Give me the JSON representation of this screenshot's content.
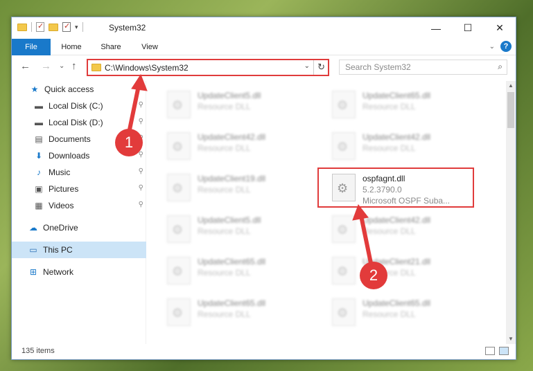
{
  "window": {
    "title": "System32",
    "minimize": "—",
    "maximize": "☐",
    "close": "✕"
  },
  "ribbon": {
    "tabs": [
      "File",
      "Home",
      "Share",
      "View"
    ],
    "help": "?",
    "expand": "⌄"
  },
  "nav": {
    "back": "←",
    "forward": "→",
    "recent": "⌄",
    "up": "↑",
    "address": "C:\\Windows\\System32",
    "address_dropdown": "⌄",
    "refresh": "↻",
    "search_placeholder": "Search System32",
    "search_icon": "⌕"
  },
  "sidebar": {
    "items": [
      {
        "label": "Quick access",
        "icon": "star-icon",
        "glyph": "★",
        "pinned": false
      },
      {
        "label": "Local Disk (C:)",
        "icon": "drive-icon",
        "glyph": "▬",
        "pinned": true
      },
      {
        "label": "Local Disk (D:)",
        "icon": "drive-icon",
        "glyph": "▬",
        "pinned": true
      },
      {
        "label": "Documents",
        "icon": "documents-icon",
        "glyph": "▤",
        "pinned": true
      },
      {
        "label": "Downloads",
        "icon": "download-icon",
        "glyph": "⬇",
        "pinned": true
      },
      {
        "label": "Music",
        "icon": "music-icon",
        "glyph": "♪",
        "pinned": true
      },
      {
        "label": "Pictures",
        "icon": "pictures-icon",
        "glyph": "▣",
        "pinned": true
      },
      {
        "label": "Videos",
        "icon": "videos-icon",
        "glyph": "▦",
        "pinned": true
      },
      {
        "label": "OneDrive",
        "icon": "cloud-icon",
        "glyph": "☁",
        "pinned": false
      },
      {
        "label": "This PC",
        "icon": "computer-icon",
        "glyph": "▭",
        "pinned": false,
        "selected": true
      },
      {
        "label": "Network",
        "icon": "network-icon",
        "glyph": "⊞",
        "pinned": false
      }
    ],
    "pin_glyph": "📌"
  },
  "files": [
    {
      "name": "UpdateClient5.dll",
      "type": "Resource DLL"
    },
    {
      "name": "UpdateClient65.dll",
      "type": "Resource DLL"
    },
    {
      "name": "UpdateClient42.dll",
      "type": "Resource DLL"
    },
    {
      "name": "UpdateClient42.dll",
      "type": "Resource DLL"
    },
    {
      "name": "UpdateClient19.dll",
      "type": "Resource DLL"
    },
    {
      "name": "ospfagnt.dll",
      "version": "5.2.3790.0",
      "description": "Microsoft OSPF Suba...",
      "highlighted": true
    },
    {
      "name": "UpdateClient5.dll",
      "type": "Resource DLL"
    },
    {
      "name": "UpdateClient42.dll",
      "type": "Resource DLL"
    },
    {
      "name": "UpdateClient65.dll",
      "type": "Resource DLL"
    },
    {
      "name": "UpdateClient21.dll",
      "type": "Resource DLL"
    },
    {
      "name": "UpdateClient65.dll",
      "type": "Resource DLL"
    },
    {
      "name": "UpdateClient65.dll",
      "type": "Resource DLL"
    }
  ],
  "status": {
    "item_count": "135 items"
  },
  "annotations": {
    "step1": "1",
    "step2": "2",
    "color": "#e23b3b"
  }
}
